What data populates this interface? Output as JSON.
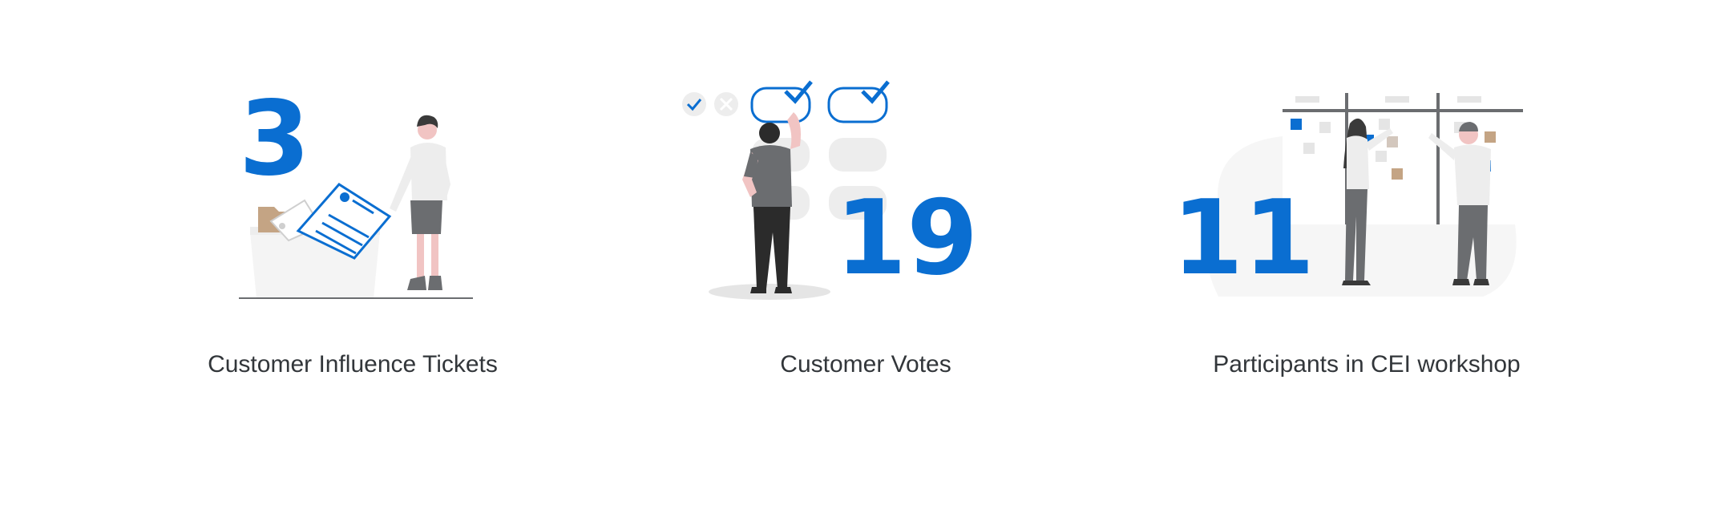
{
  "cards": [
    {
      "value": "3",
      "label": "Customer Influence Tickets",
      "illustration": "person-filing-documents-illustration"
    },
    {
      "value": "19",
      "label": "Customer Votes",
      "illustration": "person-voting-checkboxes-illustration"
    },
    {
      "value": "11",
      "label": "Participants in CEI workshop",
      "illustration": "people-at-workshop-board-illustration"
    }
  ],
  "colors": {
    "accent": "#0a6ed1",
    "text": "#32363a",
    "skin": "#f1c4c3",
    "tan": "#c4a484"
  }
}
